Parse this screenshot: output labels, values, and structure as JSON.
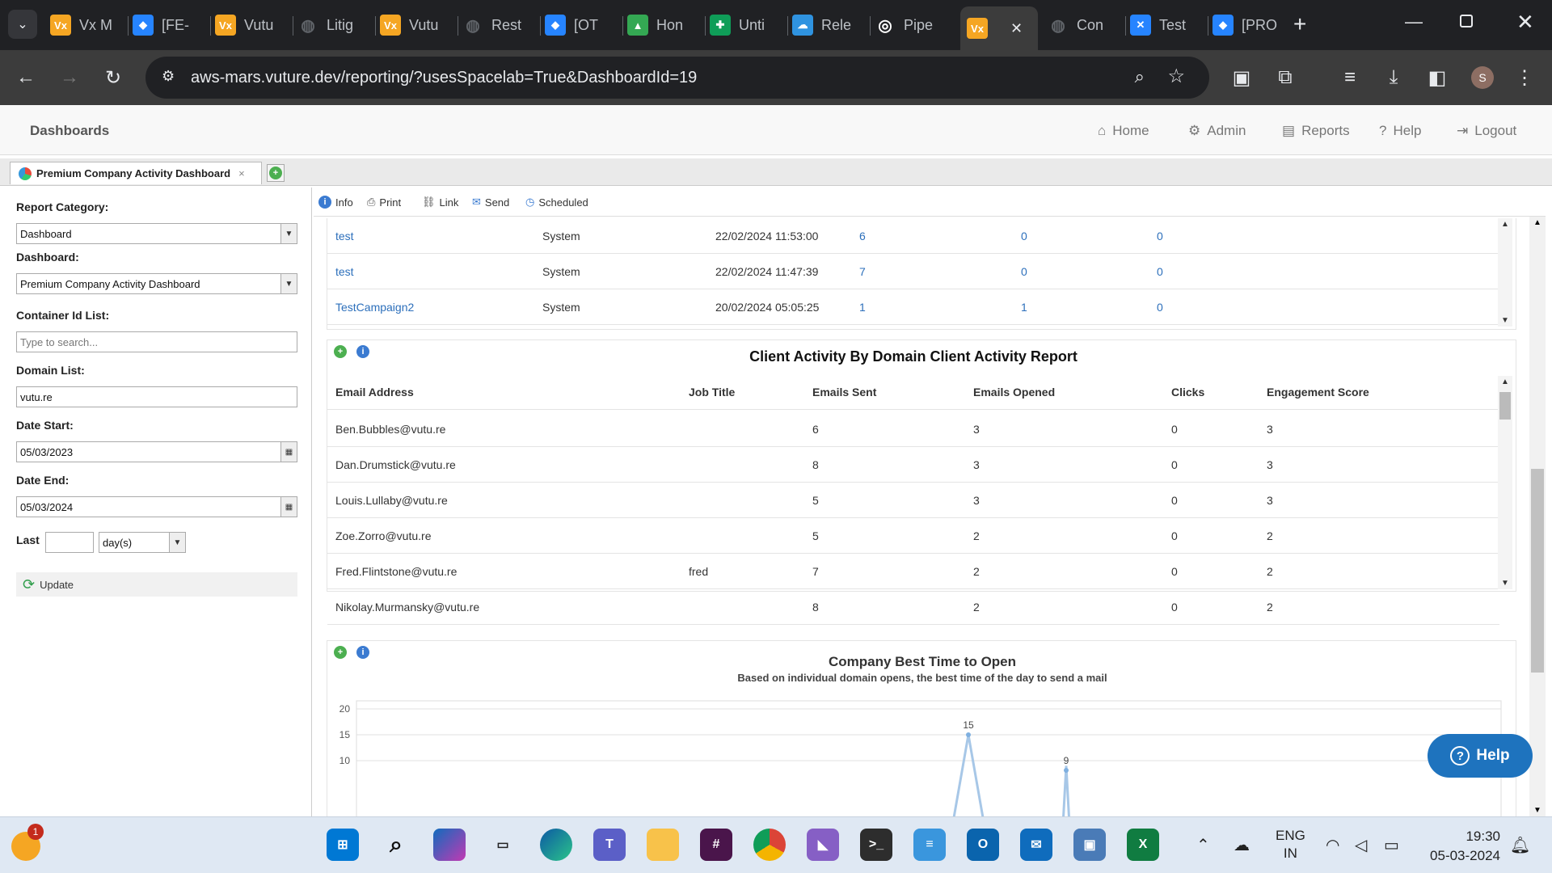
{
  "browser": {
    "tabs": [
      {
        "title": "Vx M",
        "icon": "vx-icon"
      },
      {
        "title": "[FE-",
        "icon": "jira-icon"
      },
      {
        "title": "Vutu",
        "icon": "vx-icon"
      },
      {
        "title": "Litig",
        "icon": "globe-icon"
      },
      {
        "title": "Vutu",
        "icon": "vx-icon"
      },
      {
        "title": "Rest",
        "icon": "globe-icon"
      },
      {
        "title": "[OT",
        "icon": "jira-icon"
      },
      {
        "title": "Hon",
        "icon": "drive-icon"
      },
      {
        "title": "Unti",
        "icon": "sheets-icon"
      },
      {
        "title": "Rele",
        "icon": "octopus-icon"
      },
      {
        "title": "Pipe",
        "icon": "pipedrive-icon"
      },
      {
        "title": "",
        "icon": "vx-icon",
        "active": true
      },
      {
        "title": "Con",
        "icon": "globe-icon"
      },
      {
        "title": "Test",
        "icon": "confluence-icon"
      },
      {
        "title": "[PRO",
        "icon": "jira-icon"
      }
    ],
    "new_tab": "+",
    "url": "aws-mars.vuture.dev/reporting/?usesSpacelab=True&DashboardId=19",
    "profile_initial": "S"
  },
  "app": {
    "brand": "Dashboards",
    "nav": [
      "Home",
      "Admin",
      "Reports",
      "Help",
      "Logout"
    ],
    "dashboard_tab": "Premium Company Activity Dashboard",
    "tab_close": "×"
  },
  "filters": {
    "report_category_label": "Report Category:",
    "report_category_value": "Dashboard",
    "dashboard_label": "Dashboard:",
    "dashboard_value": "Premium Company Activity Dashboard",
    "container_label": "Container Id List:",
    "container_placeholder": "Type to search...",
    "domain_label": "Domain List:",
    "domain_value": "vutu.re",
    "date_start_label": "Date Start:",
    "date_start_value": "05/03/2023",
    "date_end_label": "Date End:",
    "date_end_value": "05/03/2024",
    "last_label": "Last",
    "last_value": "",
    "last_unit": "day(s)",
    "update_label": "Update"
  },
  "report_toolbar": [
    "Info",
    "Print",
    "Link",
    "Send",
    "Scheduled"
  ],
  "campaign_rows": [
    {
      "name": "test",
      "source": "System",
      "date": "22/02/2024 11:53:00",
      "a": "6",
      "b": "0",
      "c": "0"
    },
    {
      "name": "test",
      "source": "System",
      "date": "22/02/2024 11:47:39",
      "a": "7",
      "b": "0",
      "c": "0"
    },
    {
      "name": "TestCampaign2",
      "source": "System",
      "date": "20/02/2024 05:05:25",
      "a": "1",
      "b": "1",
      "c": "0"
    }
  ],
  "client_activity": {
    "title": "Client Activity By Domain Client Activity Report",
    "columns": [
      "Email Address",
      "Job Title",
      "Emails Sent",
      "Emails Opened",
      "Clicks",
      "Engagement Score"
    ],
    "rows": [
      [
        "Ben.Bubbles@vutu.re",
        "",
        "6",
        "3",
        "0",
        "3"
      ],
      [
        "Dan.Drumstick@vutu.re",
        "",
        "8",
        "3",
        "0",
        "3"
      ],
      [
        "Louis.Lullaby@vutu.re",
        "",
        "5",
        "3",
        "0",
        "3"
      ],
      [
        "Zoe.Zorro@vutu.re",
        "",
        "5",
        "2",
        "0",
        "2"
      ],
      [
        "Fred.Flintstone@vutu.re",
        "fred",
        "7",
        "2",
        "0",
        "2"
      ],
      [
        "Nikolay.Murmansky@vutu.re",
        "",
        "8",
        "2",
        "0",
        "2"
      ]
    ]
  },
  "chart_data": {
    "type": "line",
    "title": "Company Best Time to Open",
    "subtitle": "Based on individual domain opens, the best time of the day to send a mail",
    "ylim": [
      10,
      20
    ],
    "yticks": [
      "20",
      "15",
      "10"
    ],
    "visible_points": [
      {
        "label": "15",
        "value": 15
      },
      {
        "label": "9",
        "value": 9
      }
    ]
  },
  "help_button": "Help",
  "taskbar": {
    "notification_badge": "1",
    "lang_top": "ENG",
    "lang_bottom": "IN",
    "time": "19:30",
    "date": "05-03-2024"
  }
}
